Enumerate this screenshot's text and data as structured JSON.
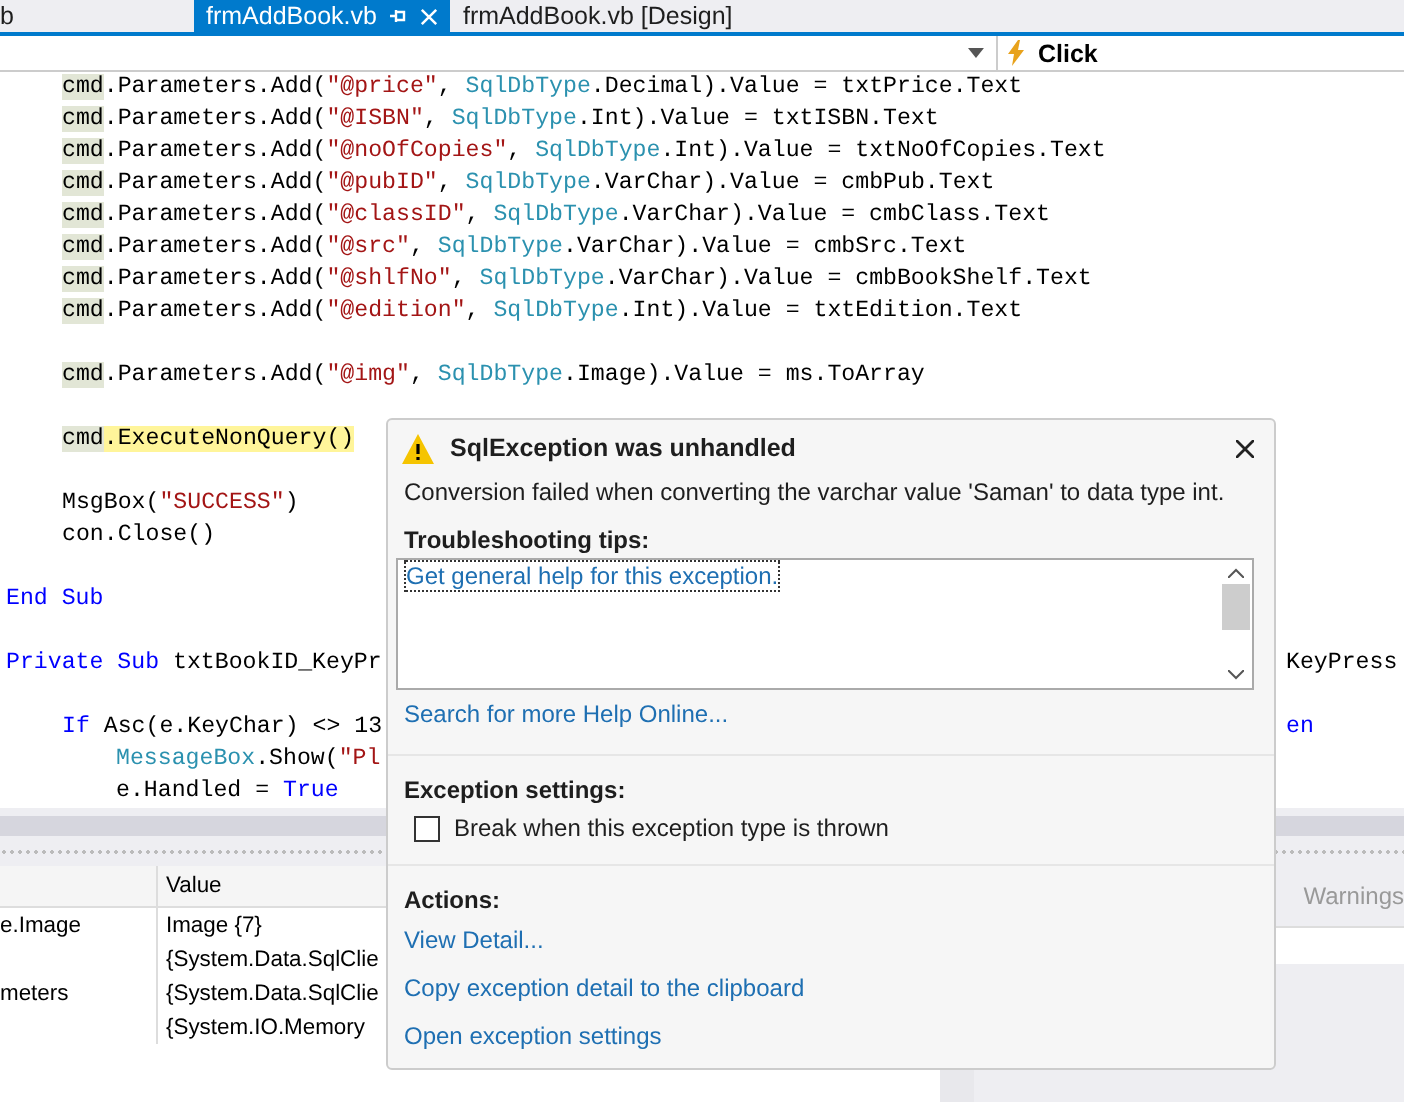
{
  "tabs": [
    {
      "label": "b",
      "selected": false,
      "pinned": false
    },
    {
      "label": "frmAddBook.vb",
      "selected": true,
      "pinned": true
    },
    {
      "label": "frmAddBook.vb [Design]",
      "selected": false,
      "pinned": false
    }
  ],
  "nav_bar": {
    "member": "Click"
  },
  "code": [
    {
      "kind": "block",
      "children": [
        {
          "kind": "code",
          "segments": [
            {
              "kind": "ref",
              "text": "cmd"
            },
            {
              "kind": "plain",
              "text": ".Parameters.Add("
            },
            {
              "kind": "string",
              "text": "\"@price\""
            },
            {
              "kind": "plain",
              "text": ", "
            },
            {
              "kind": "type",
              "text": "SqlDbType"
            },
            {
              "kind": "plain",
              "text": ".Decimal).Value = txtPrice.Text"
            }
          ]
        },
        {
          "kind": "code",
          "segments": [
            {
              "kind": "ref",
              "text": "cmd"
            },
            {
              "kind": "plain",
              "text": ".Parameters.Add("
            },
            {
              "kind": "string",
              "text": "\"@ISBN\""
            },
            {
              "kind": "plain",
              "text": ", "
            },
            {
              "kind": "type",
              "text": "SqlDbType"
            },
            {
              "kind": "plain",
              "text": ".Int).Value = txtISBN.Text"
            }
          ]
        },
        {
          "kind": "code",
          "segments": [
            {
              "kind": "ref",
              "text": "cmd"
            },
            {
              "kind": "plain",
              "text": ".Parameters.Add("
            },
            {
              "kind": "string",
              "text": "\"@noOfCopies\""
            },
            {
              "kind": "plain",
              "text": ", "
            },
            {
              "kind": "type",
              "text": "SqlDbType"
            },
            {
              "kind": "plain",
              "text": ".Int).Value = txtNoOfCopies.Text"
            }
          ]
        },
        {
          "kind": "code",
          "segments": [
            {
              "kind": "ref",
              "text": "cmd"
            },
            {
              "kind": "plain",
              "text": ".Parameters.Add("
            },
            {
              "kind": "string",
              "text": "\"@pubID\""
            },
            {
              "kind": "plain",
              "text": ", "
            },
            {
              "kind": "type",
              "text": "SqlDbType"
            },
            {
              "kind": "plain",
              "text": ".VarChar).Value = cmbPub.Text"
            }
          ]
        },
        {
          "kind": "code",
          "segments": [
            {
              "kind": "ref",
              "text": "cmd"
            },
            {
              "kind": "plain",
              "text": ".Parameters.Add("
            },
            {
              "kind": "string",
              "text": "\"@classID\""
            },
            {
              "kind": "plain",
              "text": ", "
            },
            {
              "kind": "type",
              "text": "SqlDbType"
            },
            {
              "kind": "plain",
              "text": ".VarChar).Value = cmbClass.Text"
            }
          ]
        },
        {
          "kind": "code",
          "segments": [
            {
              "kind": "ref",
              "text": "cmd"
            },
            {
              "kind": "plain",
              "text": ".Parameters.Add("
            },
            {
              "kind": "string",
              "text": "\"@src\""
            },
            {
              "kind": "plain",
              "text": ", "
            },
            {
              "kind": "type",
              "text": "SqlDbType"
            },
            {
              "kind": "plain",
              "text": ".VarChar).Value = cmbSrc.Text"
            }
          ]
        },
        {
          "kind": "code",
          "segments": [
            {
              "kind": "ref",
              "text": "cmd"
            },
            {
              "kind": "plain",
              "text": ".Parameters.Add("
            },
            {
              "kind": "string",
              "text": "\"@shlfNo\""
            },
            {
              "kind": "plain",
              "text": ", "
            },
            {
              "kind": "type",
              "text": "SqlDbType"
            },
            {
              "kind": "plain",
              "text": ".VarChar).Value = cmbBookShelf.Text"
            }
          ]
        },
        {
          "kind": "code",
          "segments": [
            {
              "kind": "ref",
              "text": "cmd"
            },
            {
              "kind": "plain",
              "text": ".Parameters.Add("
            },
            {
              "kind": "string",
              "text": "\"@edition\""
            },
            {
              "kind": "plain",
              "text": ", "
            },
            {
              "kind": "type",
              "text": "SqlDbType"
            },
            {
              "kind": "plain",
              "text": ".Int).Value = txtEdition.Text"
            }
          ]
        },
        {
          "kind": "blank"
        },
        {
          "kind": "code",
          "segments": [
            {
              "kind": "ref",
              "text": "cmd"
            },
            {
              "kind": "plain",
              "text": ".Parameters.Add("
            },
            {
              "kind": "string",
              "text": "\"@img\""
            },
            {
              "kind": "plain",
              "text": ", "
            },
            {
              "kind": "type",
              "text": "SqlDbType"
            },
            {
              "kind": "plain",
              "text": ".Image).Value = ms.ToArray"
            }
          ]
        },
        {
          "kind": "blank"
        },
        {
          "kind": "code",
          "segments": [
            {
              "kind": "ref",
              "text": "cmd"
            },
            {
              "kind": "current",
              "text": ".ExecuteNonQuery()"
            }
          ]
        },
        {
          "kind": "blank"
        },
        {
          "kind": "code",
          "segments": [
            {
              "kind": "plain",
              "text": "MsgBox("
            },
            {
              "kind": "string",
              "text": "\"SUCCESS\""
            },
            {
              "kind": "plain",
              "text": ")"
            }
          ]
        },
        {
          "kind": "code",
          "segments": [
            {
              "kind": "plain",
              "text": "con.Close()"
            }
          ]
        }
      ]
    },
    {
      "kind": "blank"
    },
    {
      "kind": "code",
      "segments": [
        {
          "kind": "keyword",
          "text": "End Sub"
        }
      ]
    },
    {
      "kind": "blank"
    },
    {
      "kind": "code",
      "segments": [
        {
          "kind": "keyword",
          "text": "Private Sub"
        },
        {
          "kind": "plain",
          "text": " txtBookID_KeyPr"
        }
      ],
      "tail": "KeyPress",
      "children": [
        {
          "kind": "blank"
        },
        {
          "kind": "code",
          "segments": [
            {
              "kind": "keyword",
              "text": "If"
            },
            {
              "kind": "plain",
              "text": " Asc(e.KeyChar) <> 13"
            }
          ],
          "tail_keyword": "en",
          "children": [
            {
              "kind": "code",
              "segments": [
                {
                  "kind": "type",
                  "text": "MessageBox"
                },
                {
                  "kind": "plain",
                  "text": ".Show("
                },
                {
                  "kind": "string",
                  "text": "\"Pl"
                }
              ]
            },
            {
              "kind": "code",
              "segments": [
                {
                  "kind": "plain",
                  "text": "e.Handled = "
                },
                {
                  "kind": "keyword",
                  "text": "True"
                }
              ]
            }
          ]
        }
      ]
    }
  ],
  "locals": {
    "columns": [
      "Value"
    ],
    "rows": [
      {
        "name": "e.Image",
        "value": "Image {7}"
      },
      {
        "value": "{System.Data.SqlClie"
      },
      {
        "name": "meters",
        "value": "{System.Data.SqlClie"
      },
      {
        "value": "{System.IO.Memory"
      }
    ]
  },
  "error_list": {
    "warnings": "Warnings"
  },
  "exception": {
    "title": "SqlException was unhandled",
    "message": "Conversion failed when converting the varchar value 'Saman' to data type int.",
    "tips_heading": "Troubleshooting tips:",
    "tips": [
      "Get general help for this exception."
    ],
    "help_link": "Search for more Help Online...",
    "settings_heading": "Exception settings:",
    "break_option": {
      "label": "Break when this exception type is thrown",
      "checked": false
    },
    "actions_heading": "Actions:",
    "actions": [
      "View Detail...",
      "Copy exception detail to the clipboard",
      "Open exception settings"
    ]
  }
}
